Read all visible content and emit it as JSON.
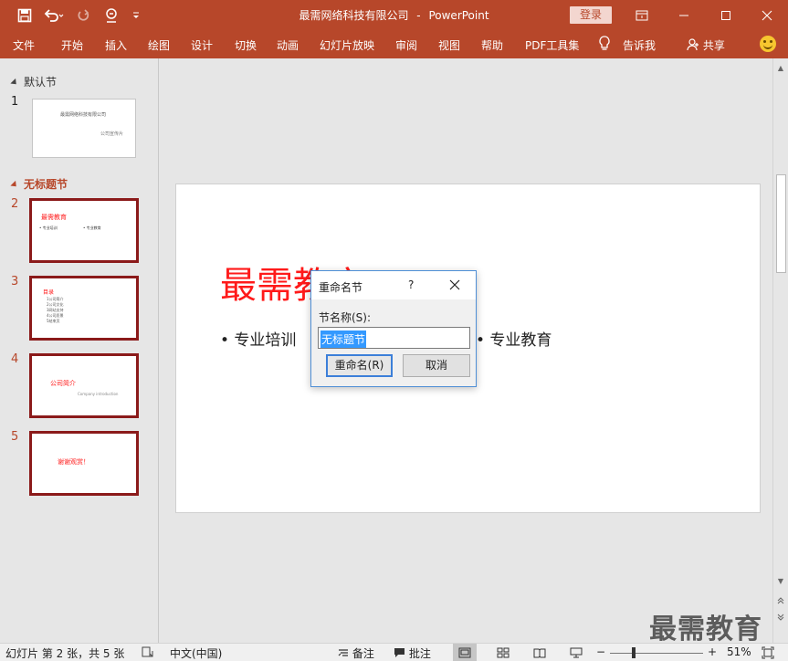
{
  "titlebar": {
    "document": "最需网络科技有限公司",
    "separator": "-",
    "app": "PowerPoint",
    "login_label": "登录",
    "qat_icons": [
      "save-icon",
      "undo-icon",
      "redo-icon",
      "touch-mode-icon",
      "customize-qat-icon"
    ]
  },
  "ribbon": {
    "tabs": [
      "文件",
      "开始",
      "插入",
      "绘图",
      "设计",
      "切换",
      "动画",
      "幻灯片放映",
      "审阅",
      "视图",
      "帮助",
      "PDF工具集"
    ],
    "tell_me": "告诉我",
    "share": "共享"
  },
  "thumbnails": {
    "sections": [
      {
        "name": "默认节"
      },
      {
        "name": "无标题节"
      }
    ],
    "slides": [
      {
        "number": "1",
        "lines": [
          "最需网络科技有限公司",
          "公司宣传片"
        ]
      },
      {
        "number": "2",
        "lines": [
          "最需教育",
          "• 专业培训",
          "• 专业教育"
        ]
      },
      {
        "number": "3",
        "lines": [
          "目录",
          "1公司简介",
          "2公司文化",
          "3网站支持",
          "4公司愿景",
          "5结束页"
        ]
      },
      {
        "number": "4",
        "lines": [
          "公司简介",
          "Company introduction"
        ]
      },
      {
        "number": "5",
        "lines": [
          "谢谢观赏！"
        ]
      }
    ]
  },
  "slide": {
    "title": "最需教育",
    "bullets": [
      "• 专业培训",
      "• 专业教育"
    ]
  },
  "dialog": {
    "title": "重命名节",
    "help": "?",
    "label": "节名称(S):",
    "value": "无标题节",
    "ok_label": "重命名(R)",
    "cancel_label": "取消"
  },
  "watermark": "最需教育",
  "statusbar": {
    "slide_info": "幻灯片 第 2 张，共 5 张",
    "language": "中文(中国)",
    "notes": "备注",
    "comments": "批注",
    "zoom_minus": "−",
    "zoom_plus": "+",
    "zoom_level": "51%",
    "zoom_fraction": 0.51
  },
  "colors": {
    "accent": "#b7472a",
    "selection_border": "#8b1a1a",
    "slide_title": "#ff1a1a",
    "dialog_border": "#4f8fd6",
    "text_selection": "#3399ff"
  }
}
